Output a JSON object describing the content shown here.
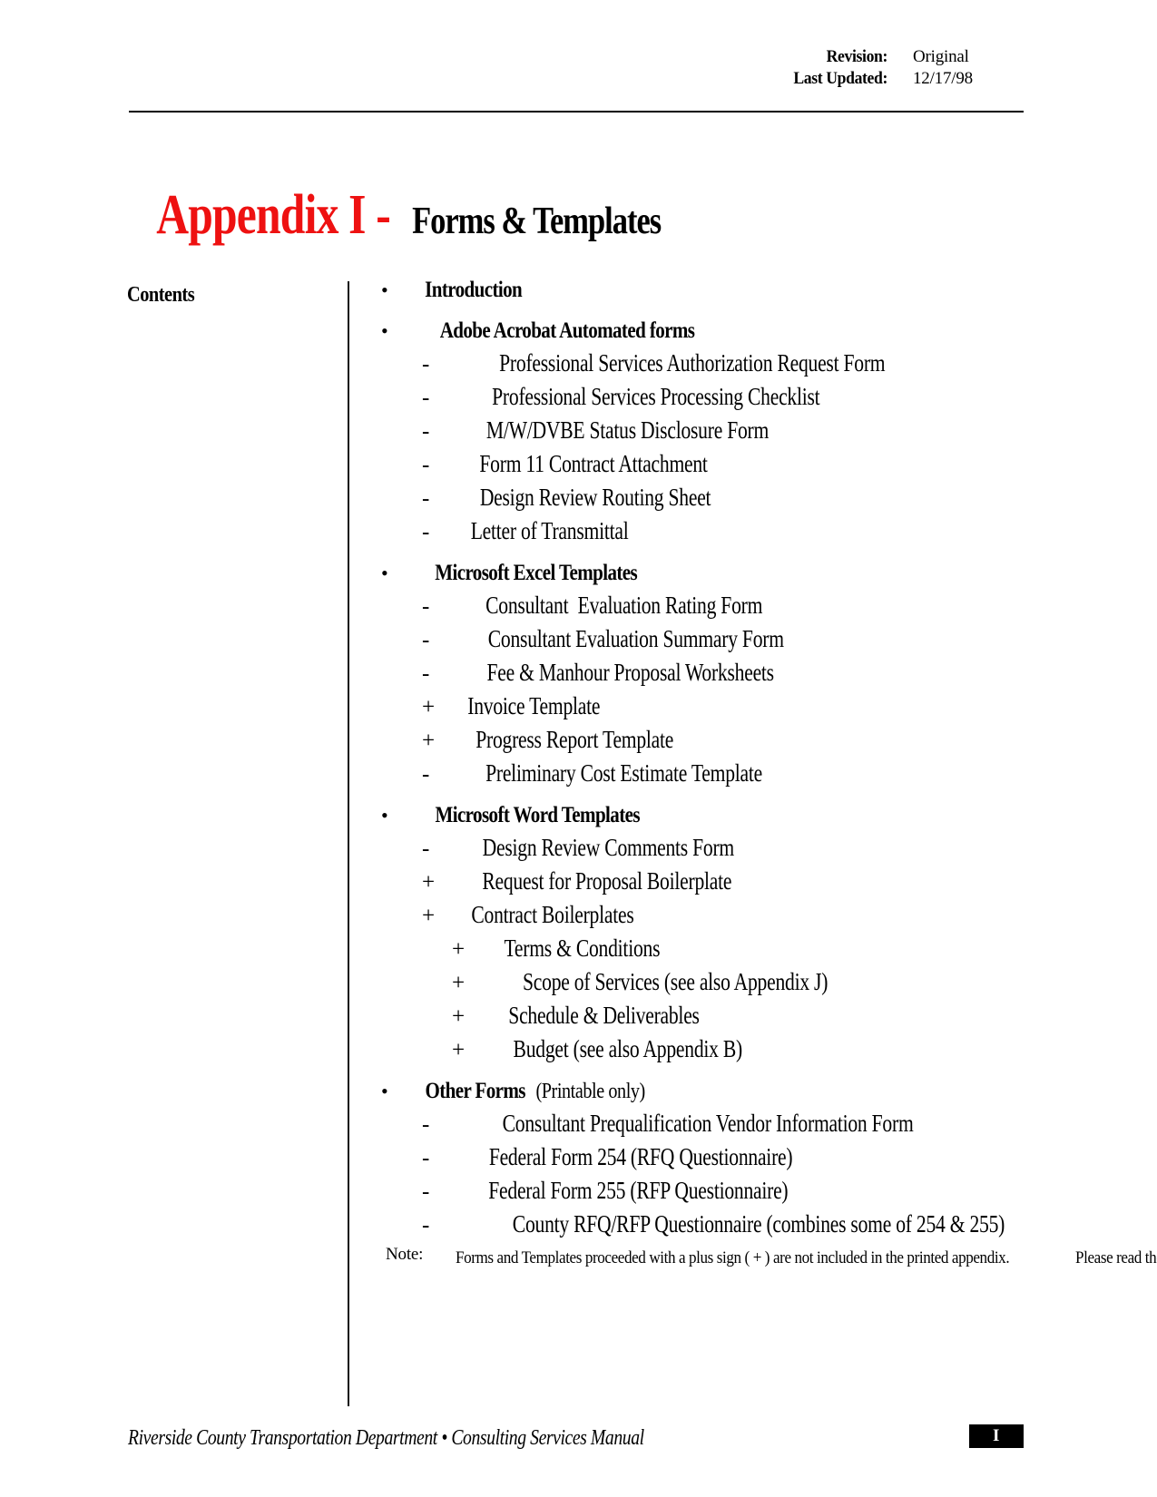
{
  "header": {
    "revision_label": "Revision:",
    "revision_value": "Original",
    "updated_label": "Last Updated:",
    "updated_value": "12/17/98"
  },
  "title": {
    "appendix": "Appendix I -",
    "subject": "Forms & Templates"
  },
  "contents": {
    "label": "Contents"
  },
  "colors": {
    "appendix_red": "#ee1111",
    "text_black": "#000000",
    "badge_bg": "#000000"
  },
  "sections": [
    {
      "marker": "•",
      "label": "Introduction",
      "extra": "",
      "children": []
    },
    {
      "marker": "•",
      "label": "Adobe Acrobat Automated forms",
      "extra": "",
      "children": [
        {
          "marker": "-",
          "label": "Professional Services Authorization Request Form"
        },
        {
          "marker": "-",
          "label": "Professional Services Processing Checklist"
        },
        {
          "marker": "-",
          "label": "M/W/DVBE Status Disclosure Form"
        },
        {
          "marker": "-",
          "label": "Form 11 Contract Attachment"
        },
        {
          "marker": "-",
          "label": "Design Review Routing Sheet"
        },
        {
          "marker": "-",
          "label": "Letter of Transmittal"
        }
      ]
    },
    {
      "marker": "•",
      "label": "Microsoft Excel Templates",
      "extra": "",
      "children": [
        {
          "marker": "-",
          "label": "Consultant  Evaluation Rating Form"
        },
        {
          "marker": "-",
          "label": "Consultant Evaluation Summary Form"
        },
        {
          "marker": "-",
          "label": "Fee & Manhour Proposal Worksheets"
        },
        {
          "marker": "+",
          "label": "Invoice Template"
        },
        {
          "marker": "+",
          "label": "Progress Report Template"
        },
        {
          "marker": "-",
          "label": "Preliminary Cost Estimate Template"
        }
      ]
    },
    {
      "marker": "•",
      "label": "Microsoft Word Templates",
      "extra": "",
      "children": [
        {
          "marker": "-",
          "label": "Design Review Comments Form"
        },
        {
          "marker": "+",
          "label": "Request for Proposal Boilerplate"
        },
        {
          "marker": "+",
          "label": "Contract Boilerplates",
          "grandchildren": [
            {
              "marker": "+",
              "label": "Terms & Conditions"
            },
            {
              "marker": "+",
              "label": "Scope of Services (see also Appendix J)"
            },
            {
              "marker": "+",
              "label": "Schedule & Deliverables"
            },
            {
              "marker": "+",
              "label": "Budget (see also Appendix B)"
            }
          ]
        }
      ]
    },
    {
      "marker": "•",
      "label": "Other Forms",
      "extra": "(Printable only)",
      "children": [
        {
          "marker": "-",
          "label": "Consultant Prequalification Vendor Information Form"
        },
        {
          "marker": "-",
          "label": "Federal Form 254 (RFQ Questionnaire)"
        },
        {
          "marker": "-",
          "label": "Federal Form 255 (RFP Questionnaire)"
        },
        {
          "marker": "-",
          "label": "County RFQ/RFP Questionnaire (combines some of 254 & 255)"
        }
      ]
    }
  ],
  "note": {
    "label": "Note:",
    "line1": "Forms and Templates proceeded with a plus sign ( + ) are not included in the printed appendix.",
    "line2": "Please read the introduction on the following page for further clarification."
  },
  "footer": {
    "text": "Riverside County Transportation Department • Consulting Services Manual",
    "page_marker": "I"
  }
}
